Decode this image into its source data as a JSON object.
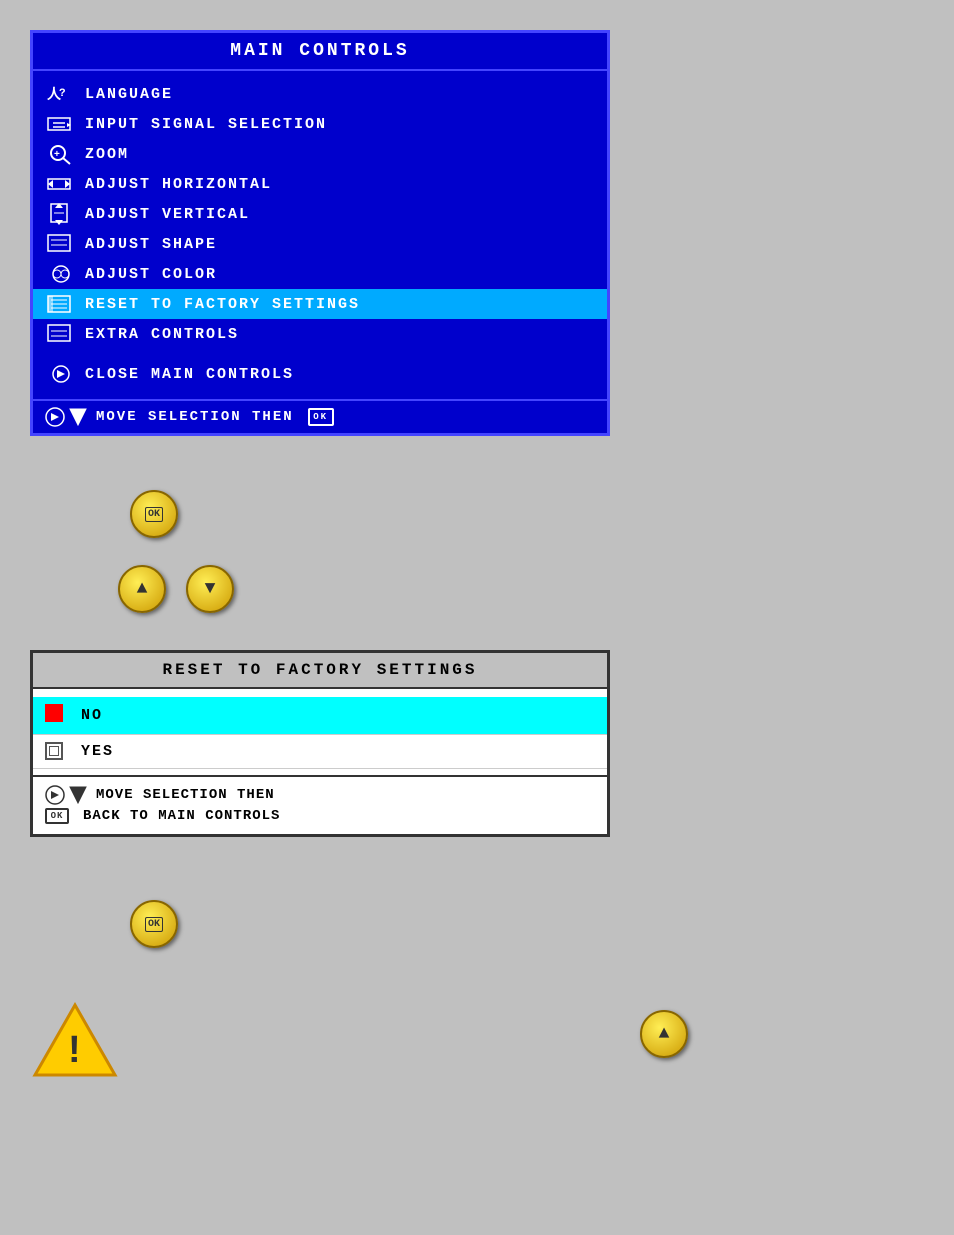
{
  "mainControls": {
    "title": "MAIN  CONTROLS",
    "items": [
      {
        "label": "LANGUAGE",
        "icon": "lang"
      },
      {
        "label": "INPUT  SIGNAL  SELECTION",
        "icon": "input"
      },
      {
        "label": "ZOOM",
        "icon": "zoom"
      },
      {
        "label": "ADJUST  HORIZONTAL",
        "icon": "horiz"
      },
      {
        "label": "ADJUST  VERTICAL",
        "icon": "vert"
      },
      {
        "label": "ADJUST  SHAPE",
        "icon": "shape"
      },
      {
        "label": "ADJUST  COLOR",
        "icon": "color"
      },
      {
        "label": "RESET  TO  FACTORY  SETTINGS",
        "icon": "reset",
        "selected": true
      },
      {
        "label": "EXTRA  CONTROLS",
        "icon": "extra"
      }
    ],
    "closeLabel": "CLOSE  MAIN  CONTROLS",
    "bottomLabel": "MOVE  SELECTION  THEN",
    "bottomOkLabel": "OK"
  },
  "navButtons": {
    "up": "▲",
    "down": "▼"
  },
  "resetPanel": {
    "title": "RESET  TO  FACTORY  SETTINGS",
    "options": [
      {
        "label": "NO",
        "icon": "red-square",
        "selected": true
      },
      {
        "label": "YES",
        "icon": "white-square"
      }
    ],
    "bottomLine1": "MOVE  SELECTION  THEN",
    "bottomLine2": "BACK  TO  MAIN  CONTROLS",
    "bottomIcon1": "move-pair",
    "bottomIcon2": "ok-badge"
  },
  "okButton": {
    "label": "OK"
  },
  "warningIcon": {
    "label": "warning"
  },
  "upArrow": {
    "label": "▲"
  }
}
